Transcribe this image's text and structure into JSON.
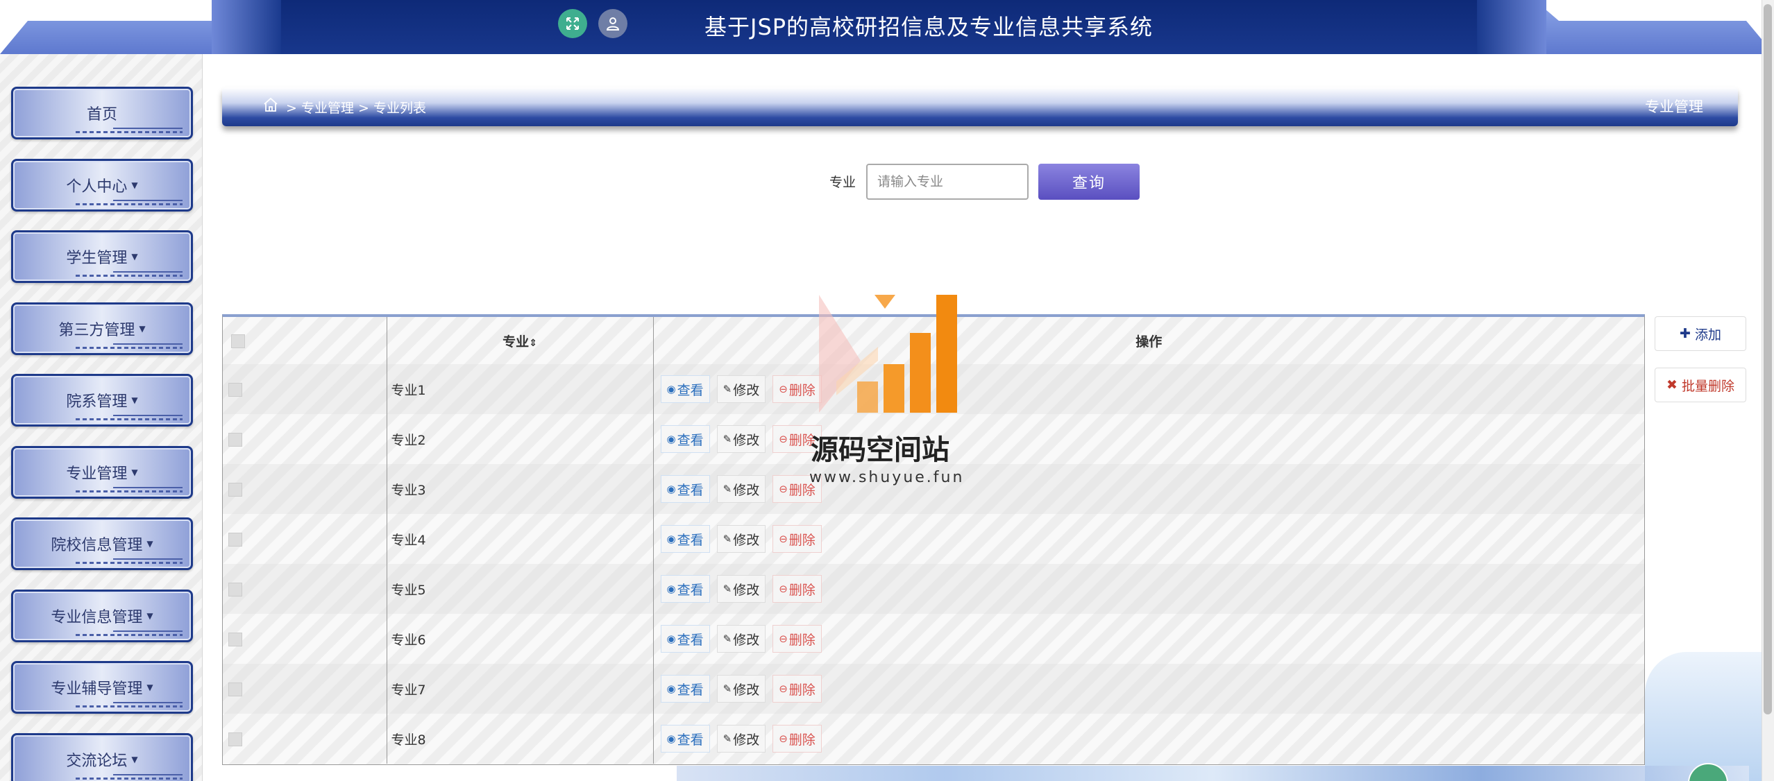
{
  "header": {
    "title": "基于JSP的高校研招信息及专业信息共享系统",
    "fullscreen_icon": "expand-icon",
    "user_icon": "user-icon"
  },
  "sidebar": {
    "items": [
      {
        "label": "首页",
        "dropdown": false
      },
      {
        "label": "个人中心",
        "dropdown": true
      },
      {
        "label": "学生管理",
        "dropdown": true
      },
      {
        "label": "第三方管理",
        "dropdown": true
      },
      {
        "label": "院系管理",
        "dropdown": true
      },
      {
        "label": "专业管理",
        "dropdown": true
      },
      {
        "label": "院校信息管理",
        "dropdown": true
      },
      {
        "label": "专业信息管理",
        "dropdown": true
      },
      {
        "label": "专业辅导管理",
        "dropdown": true
      },
      {
        "label": "交流论坛",
        "dropdown": true
      }
    ]
  },
  "breadcrumb": {
    "path": "> 专业管理 > 专业列表",
    "right_title": "专业管理"
  },
  "search": {
    "label": "专业",
    "placeholder": "请输入专业",
    "button": "查询"
  },
  "table": {
    "headers": {
      "name": "专业",
      "sort_icon": "⇕",
      "op": "操作"
    },
    "rows": [
      {
        "name": "专业1"
      },
      {
        "name": "专业2"
      },
      {
        "name": "专业3"
      },
      {
        "name": "专业4"
      },
      {
        "name": "专业5"
      },
      {
        "name": "专业6"
      },
      {
        "name": "专业7"
      },
      {
        "name": "专业8"
      }
    ],
    "actions": {
      "view": "查看",
      "edit": "修改",
      "delete": "删除"
    }
  },
  "right_actions": {
    "add": "添加",
    "batch_delete": "批量删除"
  },
  "watermark": {
    "title": "源码空间站",
    "url": "www.shuyue.fun"
  },
  "colors": {
    "header": "#0e2a78",
    "sidebar_border": "#1e3a8a",
    "search_button": "#5a4fc0",
    "delete": "#d9534f",
    "view": "#2a6ebd"
  }
}
